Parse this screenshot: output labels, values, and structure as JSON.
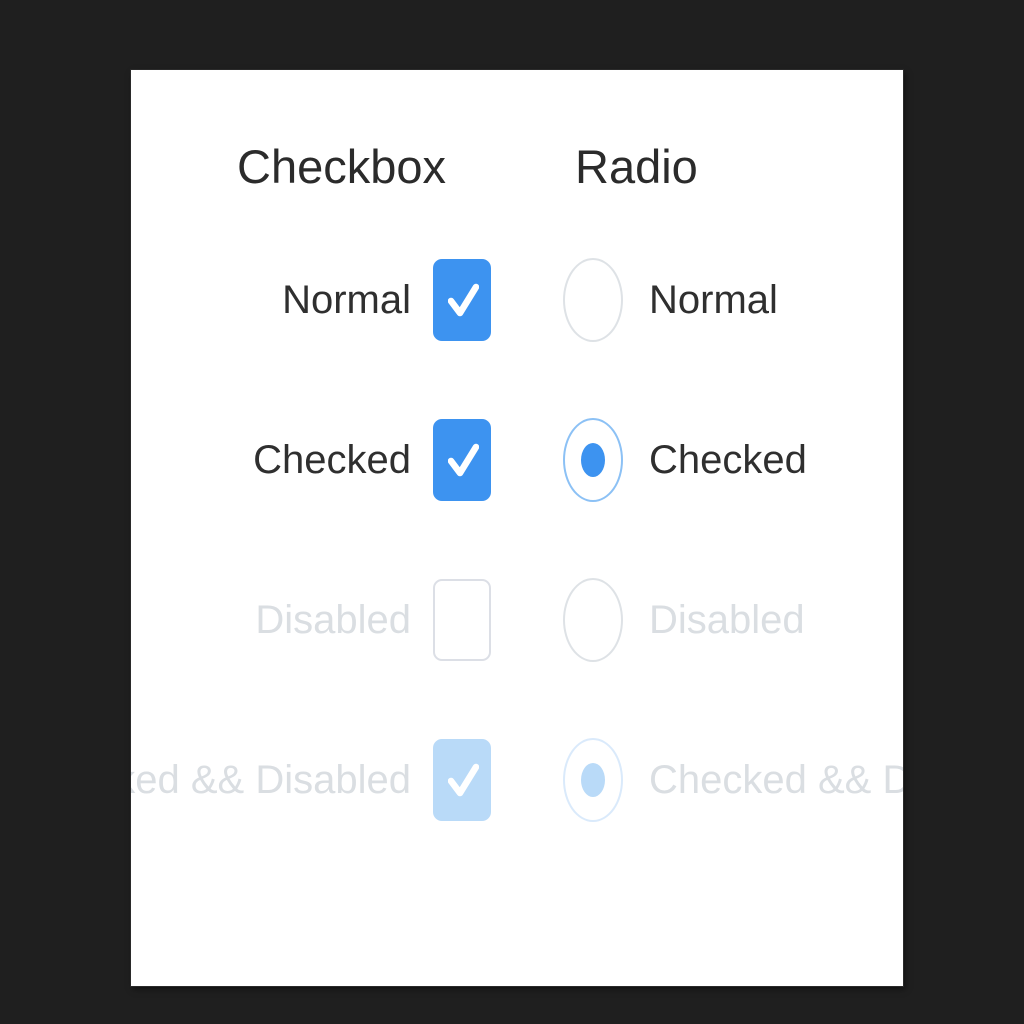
{
  "page": {
    "background_color": "#1f1f1f",
    "card_background": "#ffffff"
  },
  "colors": {
    "accent_blue": "#3d93f0",
    "accent_blue_disabled": "#b9daf8",
    "text": "#2f2f2f",
    "text_disabled": "#dadee2",
    "border_idle": "#dcdfe6"
  },
  "headers": {
    "checkbox": "Checkbox",
    "radio": "Radio"
  },
  "rows": [
    {
      "checkbox": {
        "label": "Normal",
        "checked": true,
        "disabled": false
      },
      "radio": {
        "label": "Normal",
        "checked": false,
        "disabled": false
      }
    },
    {
      "checkbox": {
        "label": "Checked",
        "checked": true,
        "disabled": false
      },
      "radio": {
        "label": "Checked",
        "checked": true,
        "disabled": false
      }
    },
    {
      "checkbox": {
        "label": "Disabled",
        "checked": false,
        "disabled": true
      },
      "radio": {
        "label": "Disabled",
        "checked": false,
        "disabled": true
      }
    },
    {
      "checkbox": {
        "label": "Checked && Disabled",
        "checked": true,
        "disabled": true
      },
      "radio": {
        "label": "Checked && Disabled",
        "checked": true,
        "disabled": true
      }
    }
  ]
}
